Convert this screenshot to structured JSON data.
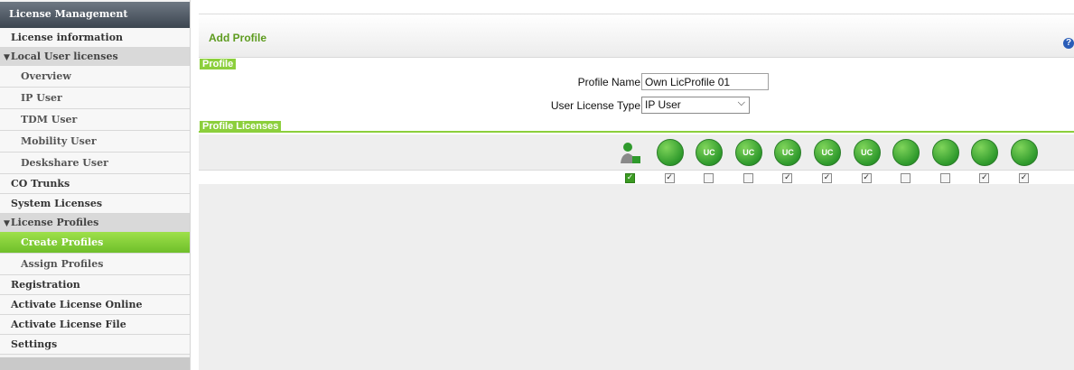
{
  "sidebar": {
    "title": "License Management",
    "items": [
      {
        "label": "License information",
        "kind": "top"
      },
      {
        "label": "Local User licenses",
        "kind": "section"
      },
      {
        "label": "Overview",
        "kind": "sub"
      },
      {
        "label": "IP User",
        "kind": "sub"
      },
      {
        "label": "TDM User",
        "kind": "sub"
      },
      {
        "label": "Mobility User",
        "kind": "sub"
      },
      {
        "label": "Deskshare User",
        "kind": "sub"
      },
      {
        "label": "CO Trunks",
        "kind": "top"
      },
      {
        "label": "System Licenses",
        "kind": "top"
      },
      {
        "label": "License Profiles",
        "kind": "section"
      },
      {
        "label": "Create Profiles",
        "kind": "sub-active"
      },
      {
        "label": "Assign Profiles",
        "kind": "sub"
      },
      {
        "label": "Registration",
        "kind": "top"
      },
      {
        "label": "Activate License Online",
        "kind": "top"
      },
      {
        "label": "Activate License File",
        "kind": "top"
      },
      {
        "label": "Settings",
        "kind": "top"
      }
    ]
  },
  "main": {
    "title": "Add Profile",
    "help_icon": "question-circle-icon",
    "profile_section": {
      "label": "Profile",
      "profile_name_label": "Profile Name",
      "profile_name_value": "Own LicProfile 01",
      "user_license_type_label": "User License Type",
      "user_license_type_value": "IP User"
    },
    "licenses_section": {
      "label": "Profile Licenses",
      "columns": [
        {
          "icon": "user-license-icon",
          "text": "",
          "checked": true,
          "locked": true
        },
        {
          "icon": "user-uc-icon",
          "text": "",
          "checked": true,
          "locked": false
        },
        {
          "icon": "uc-smart-icon",
          "text": "UC",
          "checked": false,
          "locked": false
        },
        {
          "icon": "uc-mobile-icon",
          "text": "UC",
          "checked": false,
          "locked": false
        },
        {
          "icon": "uc-user-icon",
          "text": "UC",
          "checked": true,
          "locked": false
        },
        {
          "icon": "uc-desktop-icon",
          "text": "UC",
          "checked": true,
          "locked": false
        },
        {
          "icon": "uc-conference-icon",
          "text": "UC",
          "checked": true,
          "locked": false
        },
        {
          "icon": "headset-icon",
          "text": "",
          "checked": false,
          "locked": false
        },
        {
          "icon": "agent-icon",
          "text": "",
          "checked": false,
          "locked": false
        },
        {
          "icon": "device-icon",
          "text": "",
          "checked": true,
          "locked": false
        },
        {
          "icon": "fax-icon",
          "text": "",
          "checked": true,
          "locked": false
        }
      ]
    }
  },
  "colors": {
    "accent": "#8ccf3c",
    "title": "#5d9b1e",
    "active": "#7fcf33"
  }
}
